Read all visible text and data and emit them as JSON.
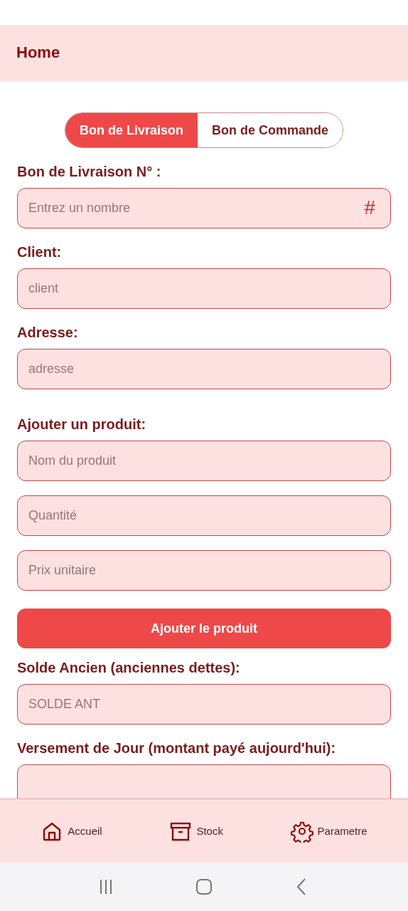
{
  "header": {
    "title": "Home"
  },
  "tabs": [
    {
      "label": "Bon de Livraison",
      "selected": true
    },
    {
      "label": "Bon de Commande",
      "selected": false
    }
  ],
  "sections": [
    {
      "title": "Bon de Livraison N° :",
      "items": [
        {
          "kind": "field",
          "placeholder": "Entrez un nombre",
          "suffix": "#"
        }
      ]
    },
    {
      "title": "Client:",
      "items": [
        {
          "kind": "field",
          "placeholder": "client"
        }
      ]
    },
    {
      "title": "Adresse:",
      "items": [
        {
          "kind": "field",
          "placeholder": "adresse"
        }
      ]
    },
    {
      "title": "Ajouter un produit:",
      "items": [
        {
          "kind": "field",
          "placeholder": "Nom du produit"
        },
        {
          "kind": "field",
          "placeholder": "Quantité"
        },
        {
          "kind": "field",
          "placeholder": "Prix unitaire"
        },
        {
          "kind": "button",
          "label": "Ajouter le produit"
        }
      ]
    },
    {
      "title": "Solde Ancien (anciennes dettes):",
      "items": [
        {
          "kind": "field",
          "placeholder": "SOLDE ANT"
        }
      ]
    },
    {
      "title": "Versement de Jour (montant payé aujourd'hui):",
      "items": [
        {
          "kind": "field"
        }
      ]
    }
  ],
  "bottom_nav": [
    {
      "label": "Accueil"
    },
    {
      "label": "Stock"
    },
    {
      "label": "Parametre"
    }
  ]
}
